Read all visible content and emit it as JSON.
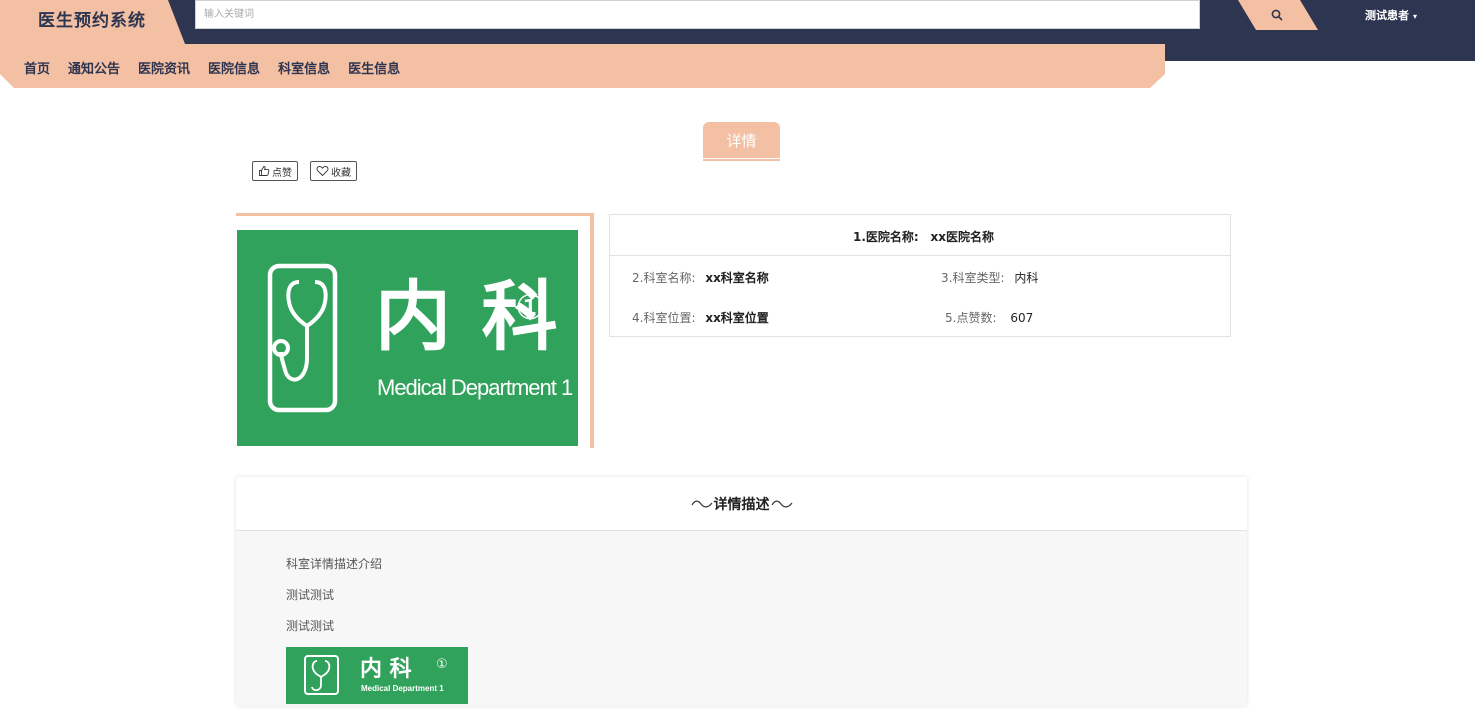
{
  "header": {
    "logo": "医生预约系统",
    "search_placeholder": "输入关键词",
    "user_name": "测试患者",
    "caret": "▾"
  },
  "nav": {
    "items": [
      "首页",
      "通知公告",
      "医院资讯",
      "医院信息",
      "科室信息",
      "医生信息"
    ]
  },
  "detail": {
    "title": "详情",
    "like_label": "点赞",
    "collect_label": "收藏",
    "image": {
      "title_cn": "内 科",
      "num": "①",
      "subtitle_en": "Medical Department 1"
    },
    "info": {
      "hospital_label": "1.医院名称:",
      "hospital_value": "xx医院名称",
      "dept_name_label": "2.科室名称:",
      "dept_name_value": "xx科室名称",
      "dept_type_label": "3.科室类型:",
      "dept_type_value": "内科",
      "location_label": "4.科室位置:",
      "location_value": "xx科室位置",
      "likes_label": "5.点赞数:",
      "likes_value": "607"
    }
  },
  "description": {
    "heading": "详情描述",
    "lines": [
      "科室详情描述介绍",
      "测试测试",
      "测试测试"
    ],
    "image": {
      "title_cn": "内 科",
      "num": "①",
      "subtitle_en": "Medical Department 1"
    }
  },
  "colors": {
    "accent": "#f4c0a4",
    "header_dark": "#2e3550",
    "sign_green": "#31a25c"
  }
}
